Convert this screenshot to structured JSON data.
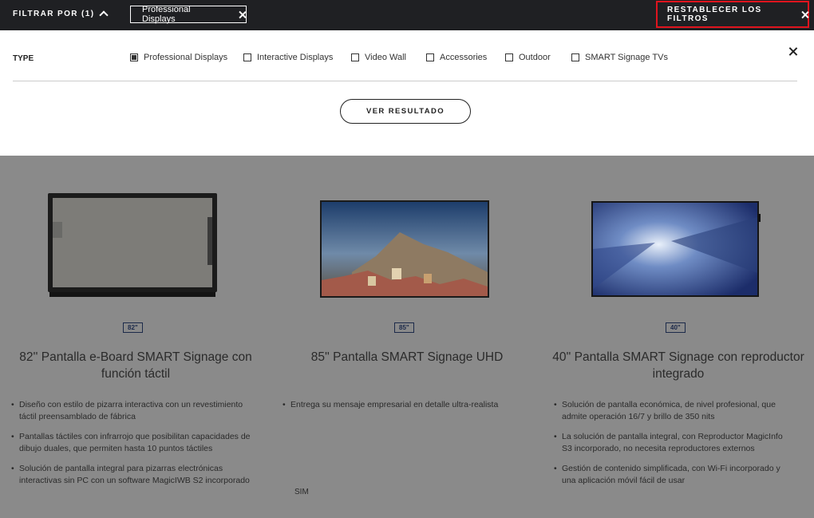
{
  "topbar": {
    "filter_label": "FILTRAR POR (1)",
    "active_chip": "Professional Displays",
    "reset_label": "RESTABLECER LOS FILTROS"
  },
  "filters": {
    "type_label": "TYPE",
    "options": [
      {
        "label": "Professional Displays",
        "checked": true
      },
      {
        "label": "Interactive Displays",
        "checked": false
      },
      {
        "label": "Video Wall",
        "checked": false
      },
      {
        "label": "Accessories",
        "checked": false
      },
      {
        "label": "Outdoor",
        "checked": false
      },
      {
        "label": "SMART Signage TVs",
        "checked": false
      }
    ],
    "result_button": "VER RESULTADO"
  },
  "products": [
    {
      "size": "82\"",
      "title": "82'' Pantalla e-Board SMART Signage con función táctil",
      "bullets": [
        "Diseño con estilo de pizarra interactiva con un revestimiento táctil preensamblado de fábrica",
        "Pantallas táctiles con infrarrojo que posibilitan capacidades de dibujo duales, que permiten hasta 10 puntos táctiles",
        "Solución de pantalla integral para pizarras electrónicas interactivas sin PC con un software MagicIWB S2 incorporado"
      ]
    },
    {
      "size": "85\"",
      "title": "85'' Pantalla SMART Signage UHD",
      "bullets": [
        "Entrega su mensaje empresarial en detalle ultra-realista"
      ],
      "extra": "SIM"
    },
    {
      "size": "40\"",
      "title": "40'' Pantalla SMART Signage con reproductor integrado",
      "bullets": [
        "Solución de pantalla económica, de nivel profesional, que admite operación 16/7 y brillo de 350 nits",
        "La solución de pantalla integral, con Reproductor MagicInfo S3 incorporado, no necesita reproductores externos",
        "Gestión de contenido simplificada, con Wi-Fi incorporado y una aplicación móvil fácil de usar"
      ]
    }
  ],
  "colors": {
    "topbar_bg": "#1f2023",
    "reset_highlight": "#e0141e",
    "overlay_bg": "#8a8a8a"
  }
}
